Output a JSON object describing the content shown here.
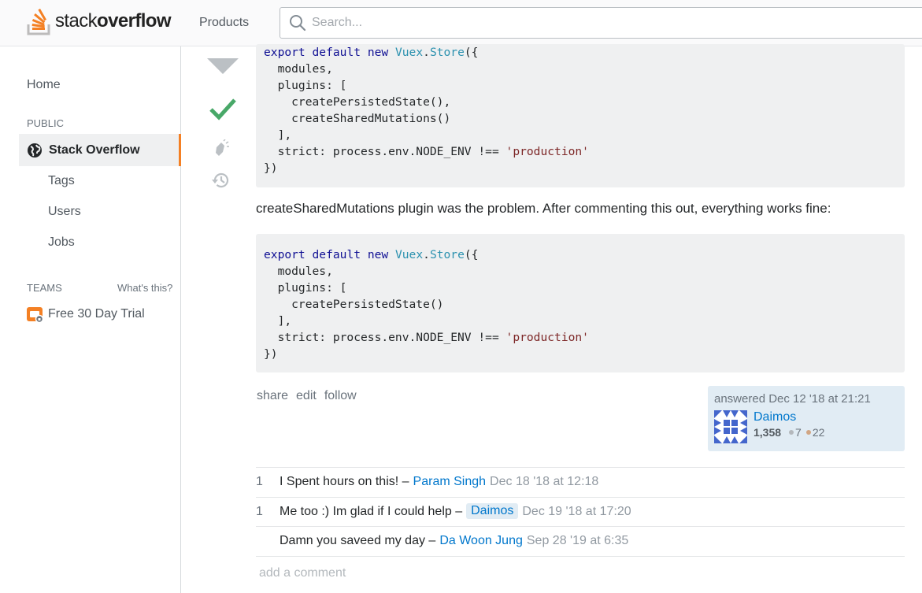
{
  "header": {
    "logo_light": "stack",
    "logo_bold": "overflow",
    "products_label": "Products",
    "search_placeholder": "Search..."
  },
  "sidebar": {
    "home": "Home",
    "public_label": "PUBLIC",
    "active_item": "Stack Overflow",
    "items": [
      "Tags",
      "Users",
      "Jobs"
    ],
    "teams_label": "TEAMS",
    "whats_this": "What's this?",
    "trial": "Free 30 Day Trial"
  },
  "answer": {
    "code_block_1": [
      [
        [
          "kw",
          "export"
        ],
        [
          "t",
          " "
        ],
        [
          "kw",
          "default"
        ],
        [
          "t",
          " "
        ],
        [
          "kw",
          "new"
        ],
        [
          "t",
          " "
        ],
        [
          "ty",
          "Vuex"
        ],
        [
          "t",
          "."
        ],
        [
          "ty",
          "Store"
        ],
        [
          "t",
          "({"
        ]
      ],
      [
        [
          "t",
          "  modules,"
        ]
      ],
      [
        [
          "t",
          "  plugins: ["
        ]
      ],
      [
        [
          "t",
          "    createPersistedState(),"
        ]
      ],
      [
        [
          "t",
          "    createSharedMutations()"
        ]
      ],
      [
        [
          "t",
          "  ],"
        ]
      ],
      [
        [
          "t",
          "  strict: process.env.NODE_ENV !== "
        ],
        [
          "st",
          "'production'"
        ]
      ],
      [
        [
          "t",
          "})"
        ]
      ]
    ],
    "text": "createSharedMutations plugin was the problem. After commenting this out, everything works fine:",
    "code_block_2": [
      [
        [
          "kw",
          "export"
        ],
        [
          "t",
          " "
        ],
        [
          "kw",
          "default"
        ],
        [
          "t",
          " "
        ],
        [
          "kw",
          "new"
        ],
        [
          "t",
          " "
        ],
        [
          "ty",
          "Vuex"
        ],
        [
          "t",
          "."
        ],
        [
          "ty",
          "Store"
        ],
        [
          "t",
          "({"
        ]
      ],
      [
        [
          "t",
          "  modules,"
        ]
      ],
      [
        [
          "t",
          "  plugins: ["
        ]
      ],
      [
        [
          "t",
          "    createPersistedState()"
        ]
      ],
      [
        [
          "t",
          "  ],"
        ]
      ],
      [
        [
          "t",
          "  strict: process.env.NODE_ENV !== "
        ],
        [
          "st",
          "'production'"
        ]
      ],
      [
        [
          "t",
          "})"
        ]
      ]
    ],
    "menu": {
      "share": "share",
      "edit": "edit",
      "follow": "follow"
    },
    "signature": {
      "action": "answered Dec 12 '18 at 21:21",
      "user": "Daimos",
      "reputation": "1,358",
      "silver": "7",
      "bronze": "22",
      "silver_color": "#b4b8bc",
      "bronze_color": "#d1a684"
    }
  },
  "comments": [
    {
      "score": "1",
      "text": "I Spent hours on this! –",
      "user": "Param Singh",
      "op": false,
      "date": "Dec 18 '18 at 12:18"
    },
    {
      "score": "1",
      "text": "Me too :) Im glad if I could help –",
      "user": "Daimos",
      "op": true,
      "date": "Dec 19 '18 at 17:20"
    },
    {
      "score": "",
      "text": "Damn you saveed my day –",
      "user": "Da Woon Jung",
      "op": false,
      "date": "Sep 28 '19 at 6:35"
    }
  ],
  "add_comment": "add a comment",
  "colors": {
    "accent": "#f48024",
    "link": "#0077cc",
    "accepted": "#48a868"
  }
}
